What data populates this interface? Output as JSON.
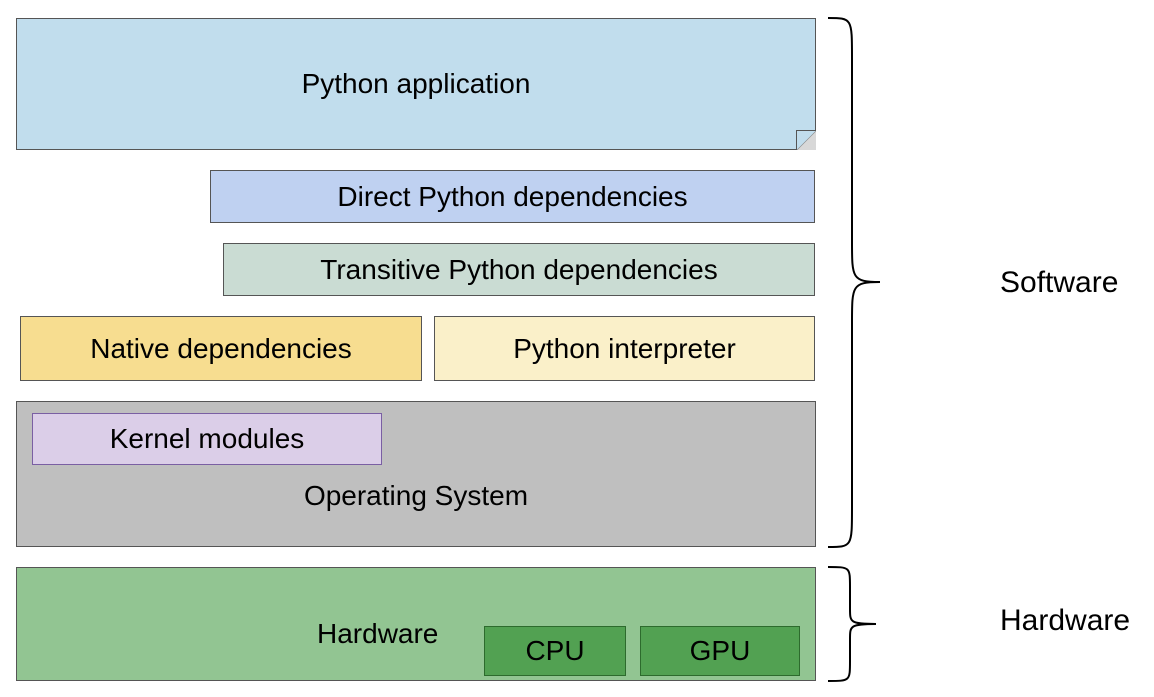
{
  "layers": {
    "app": "Python application",
    "direct_deps": "Direct Python dependencies",
    "transitive_deps": "Transitive Python dependencies",
    "native_deps": "Native dependencies",
    "interpreter": "Python interpreter",
    "kernel": "Kernel modules",
    "os": "Operating System",
    "hardware": "Hardware",
    "cpu": "CPU",
    "gpu": "GPU"
  },
  "groups": {
    "software": "Software",
    "hardware": "Hardware"
  },
  "colors": {
    "app": "#c1dded",
    "direct_deps": "#bfd1f1",
    "transitive_deps": "#cadcd3",
    "native_deps": "#f7dd90",
    "interpreter": "#faf0c9",
    "os": "#bfbfbf",
    "kernel": "#dbcee8",
    "hardware": "#92c592",
    "cpu": "#52a152",
    "gpu": "#52a152"
  }
}
